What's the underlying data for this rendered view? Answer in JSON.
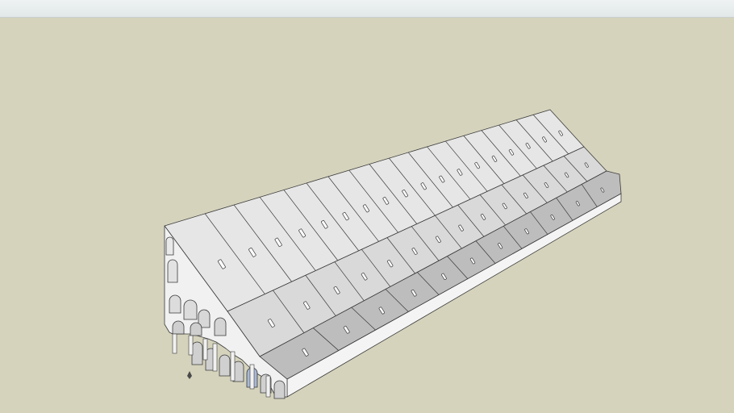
{
  "colors": {
    "sky": "#d5d3bc",
    "top_bar": "#e6ecec",
    "roof": "#e6e6e6",
    "roof_lower": "#d9d9d9",
    "roof_front": "#f4f4f4",
    "front_face": "#f1f1f1",
    "shadow_face": "#bdbdbd",
    "edge": "#3a3a3a",
    "skylight": "#ffffff",
    "opening": "#a9b8d4"
  },
  "model": {
    "upper_bays": 18,
    "middle_bays": 14,
    "lower_bays": 11,
    "ground_arches": 7
  }
}
